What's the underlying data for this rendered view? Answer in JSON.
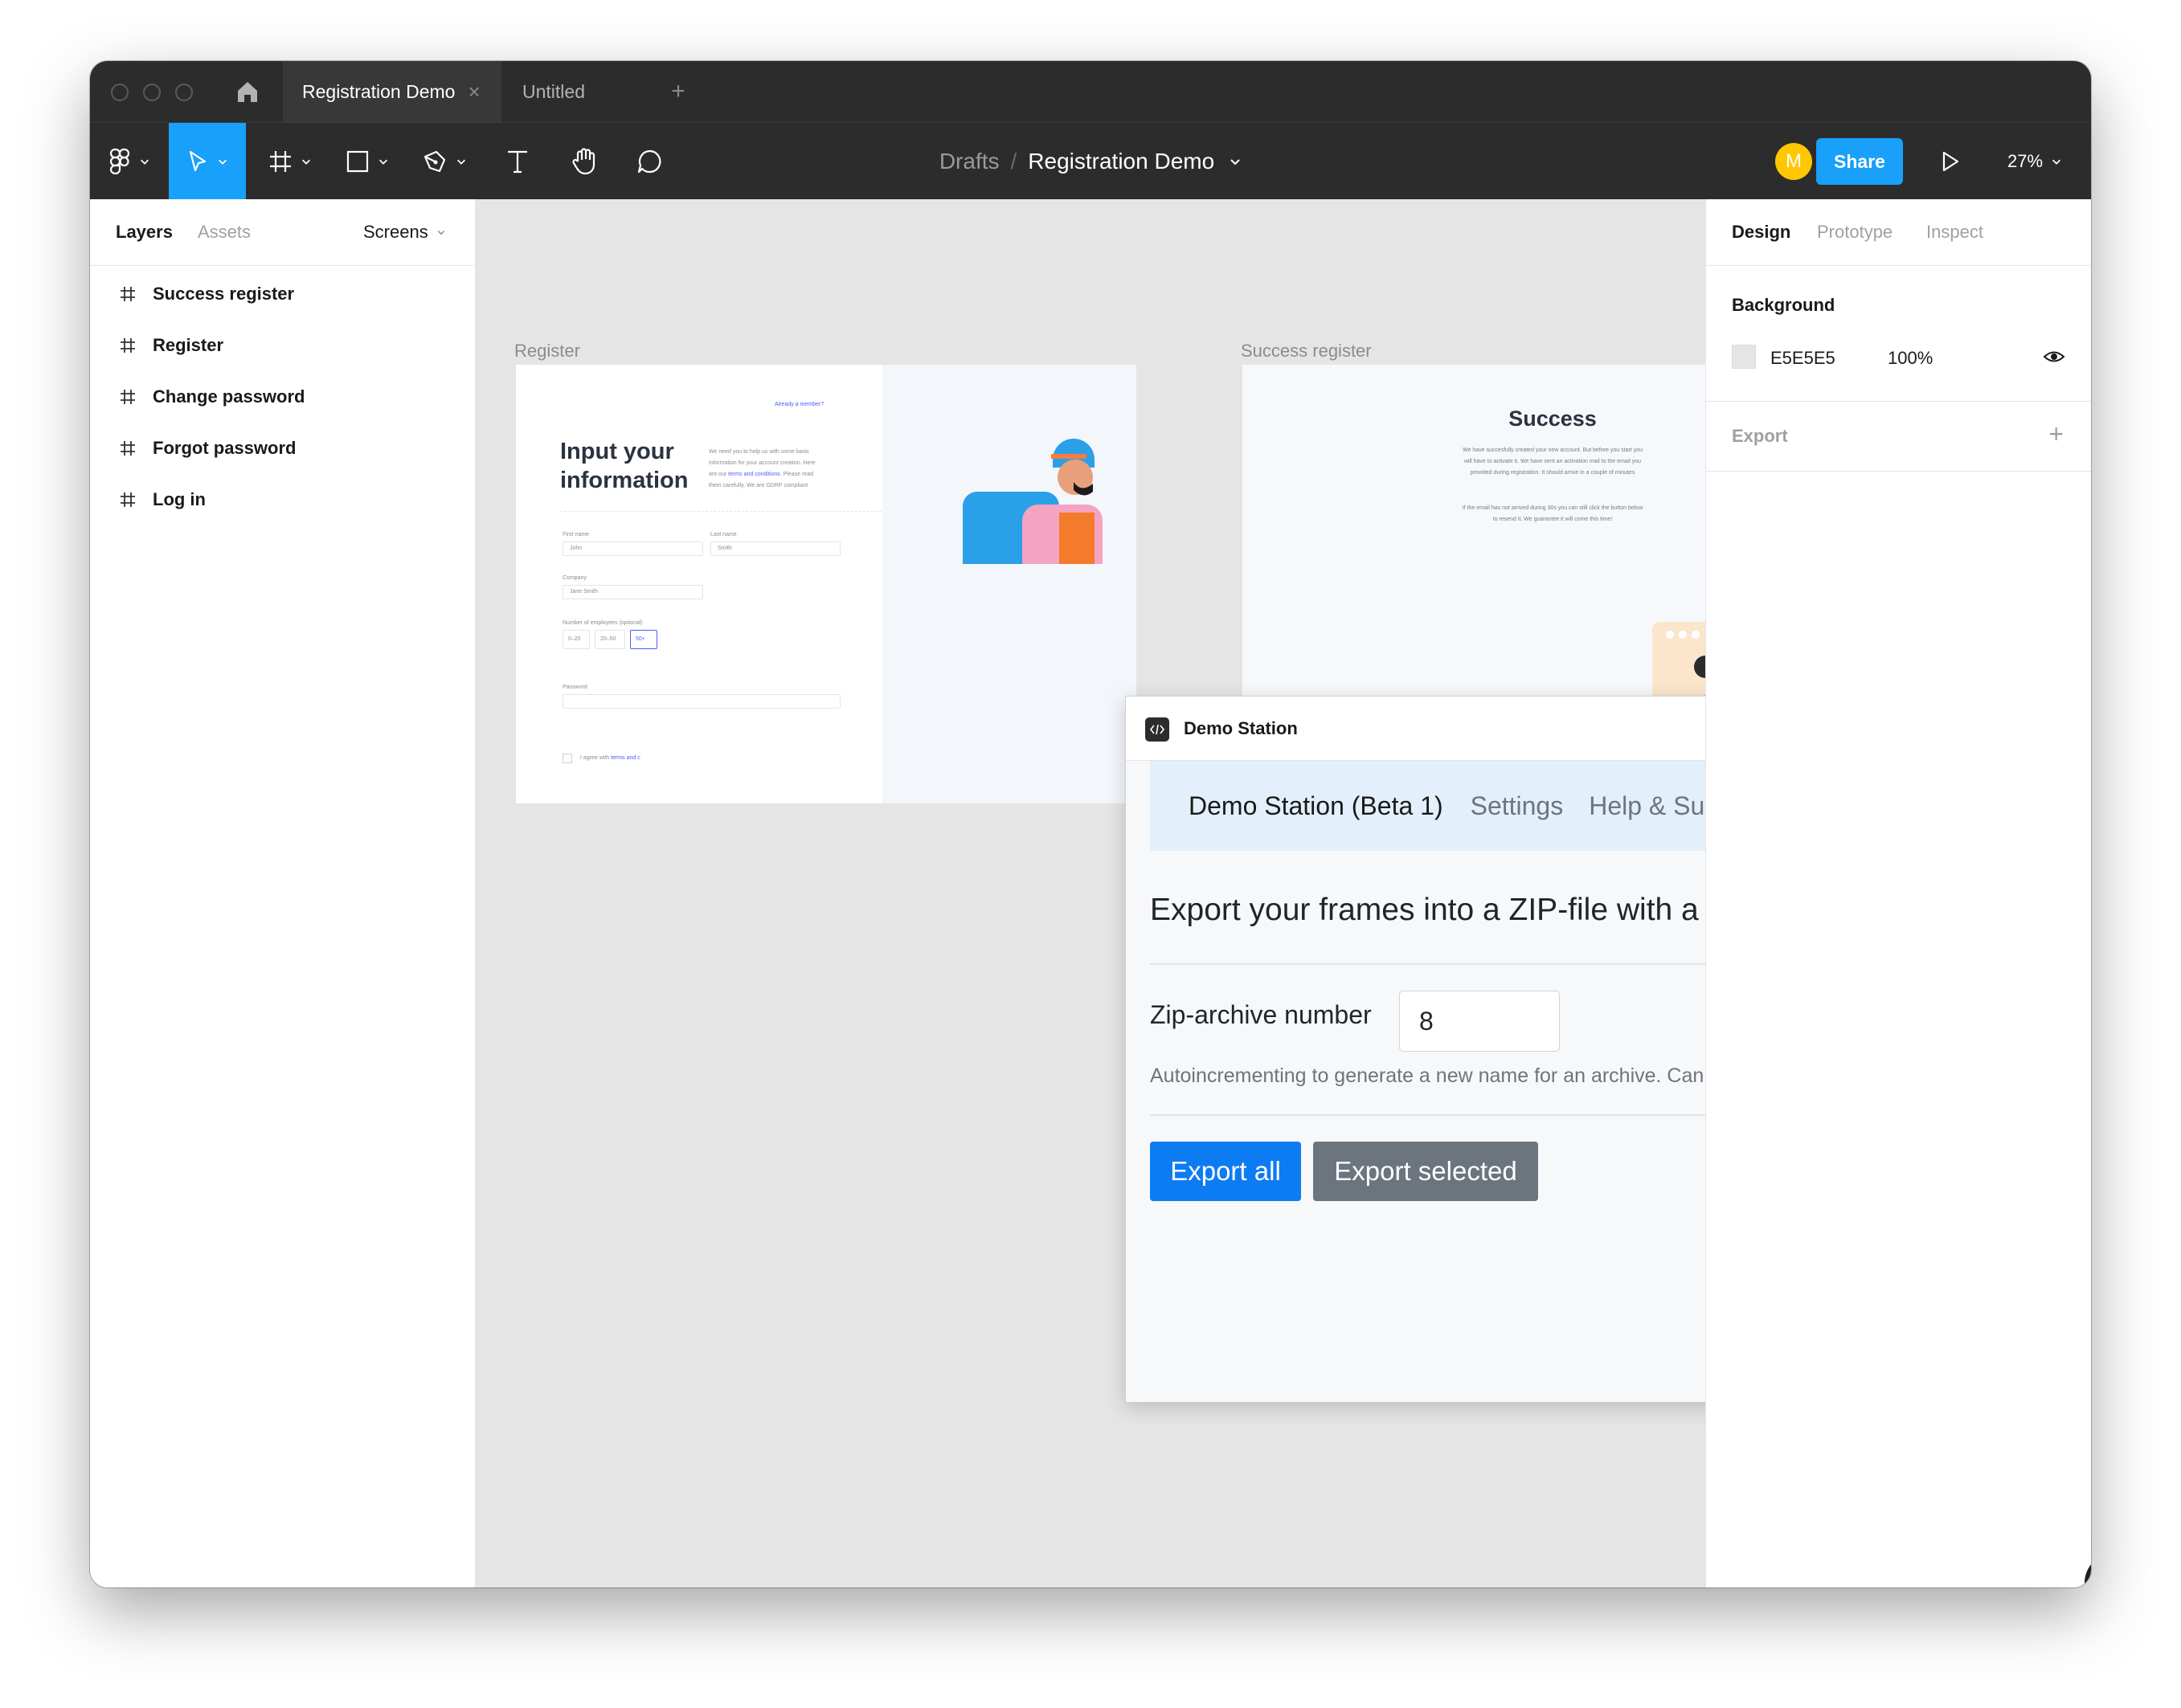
{
  "titlebar": {
    "tabs": [
      {
        "label": "Registration Demo",
        "active": true
      },
      {
        "label": "Untitled",
        "active": false
      }
    ],
    "add_tab": "+",
    "close_tab": "×"
  },
  "toolbar": {
    "breadcrumb_parent": "Drafts",
    "breadcrumb_sep": "/",
    "file_name": "Registration Demo",
    "avatar_initial": "M",
    "share_label": "Share",
    "zoom": "27%"
  },
  "left_panel": {
    "tab_layers": "Layers",
    "tab_assets": "Assets",
    "pages_dropdown": "Screens",
    "layers": [
      "Success register",
      "Register",
      "Change password",
      "Forgot password",
      "Log in"
    ]
  },
  "right_panel": {
    "tab_design": "Design",
    "tab_prototype": "Prototype",
    "tab_inspect": "Inspect",
    "background_label": "Background",
    "background_hex": "E5E5E5",
    "background_opacity": "100%",
    "export_label": "Export",
    "export_add": "+"
  },
  "canvas": {
    "frame1_label": "Register",
    "frame2_label": "Success register",
    "register": {
      "title_line1": "Input your",
      "title_line2": "information",
      "already_member": "Already a member?",
      "desc1": "We need you to help us with some basic",
      "desc2": "information for your account creation. Here",
      "desc3": "are our",
      "desc_link": "terms and conditions",
      "desc3b": ". Please read",
      "desc4": "them carefully. We are GDRP compliant",
      "first_name_label": "First name",
      "first_name_placeholder": "John",
      "last_name_label": "Last name",
      "last_name_placeholder": "Smith",
      "company_label": "Company",
      "company_placeholder": "Jane Smith",
      "employees_label": "Number of employees",
      "employees_optional": "(optional)",
      "employee_opt1": "0–20",
      "employee_opt2": "20–50",
      "employee_opt3": "50+",
      "password_label": "Password",
      "agree_text": "I agree with",
      "agree_link": "terms and c"
    },
    "success": {
      "title": "Success",
      "text1": "We have succesfully created your new account. But before you start you",
      "text2": "will have to activate it. We have sent an activation mail to the email you",
      "text3": "provided during registration. It should arrive in a couple of minutes",
      "text4": "If the email has not arrived during 30s you can still click the button below",
      "text5": "to resend it. We guarantee it will come this time!"
    }
  },
  "plugin": {
    "title": "Demo Station",
    "nav": [
      "Demo Station (Beta 1)",
      "Settings",
      "Help & Support"
    ],
    "heading": "Export your frames into a ZIP-file with a clickable prototype inside",
    "zip_label": "Zip-archive number",
    "zip_value": "8",
    "zip_hint": "Autoincrementing to generate a new name for an archive. Can be empty",
    "export_all": "Export all",
    "export_selected": "Export selected"
  },
  "help_button": "?",
  "colors": {
    "accent": "#18a0fb",
    "primary_button": "#0d7cf2",
    "secondary_button": "#6c757d",
    "avatar": "#ffc700",
    "canvas_bg": "#e5e5e5",
    "chrome": "#2c2c2c"
  }
}
